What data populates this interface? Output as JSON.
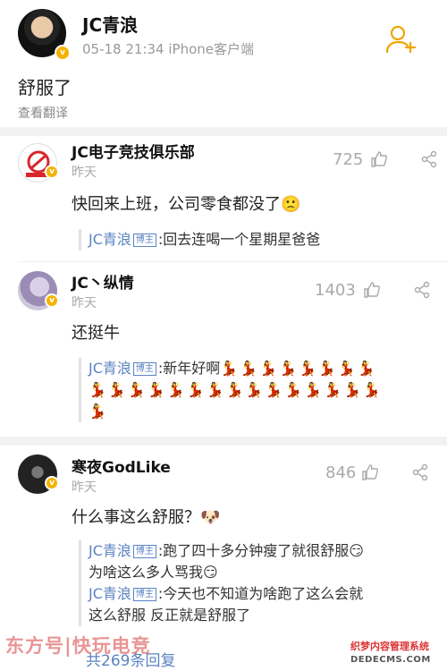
{
  "post": {
    "author": "JC青浪",
    "meta": "05-18 21:34   iPhone客户端",
    "text": "舒服了",
    "translate": "查看翻译"
  },
  "comments": [
    {
      "name": "JC电子竞技俱乐部",
      "time": "昨天",
      "likes": "725",
      "text": "快回来上班，公司零食都没了🙁",
      "replies": [
        {
          "name": "JC青浪",
          "badge": "博主",
          "text": ":回去连喝一个星期星爸爸"
        }
      ]
    },
    {
      "name": "JC丶纵情",
      "time": "昨天",
      "likes": "1403",
      "text": "还挺牛",
      "replies": [
        {
          "name": "JC青浪",
          "badge": "博主",
          "text": ":新年好啊",
          "emoji": "💃💃💃💃💃💃💃💃",
          "emoji2": "💃💃💃💃💃💃💃💃💃💃💃💃💃💃💃",
          "emoji3": "💃"
        }
      ]
    },
    {
      "name": "寒夜GodLike",
      "time": "昨天",
      "likes": "846",
      "text": "什么事这么舒服？🐶",
      "replies": [
        {
          "name": "JC青浪",
          "badge": "博主",
          "text": ":跑了四十多分钟瘦了就很舒服😏",
          "text2": "为啥这么多人骂我😏"
        },
        {
          "name": "JC青浪",
          "badge": "博主",
          "text": ":今天也不知道为啥跑了这么会就",
          "text2": "这么舒服 反正就是舒服了"
        }
      ],
      "reply_count": "共269条回复"
    }
  ],
  "watermark": {
    "left": "东方号|快玩电竞",
    "right_top": "织梦内容管理系统",
    "right_bottom": "DEDECMS.COM"
  },
  "colors": {
    "link": "#5b83c2",
    "badge": "#f5b301",
    "muted": "#aaaaaa"
  }
}
